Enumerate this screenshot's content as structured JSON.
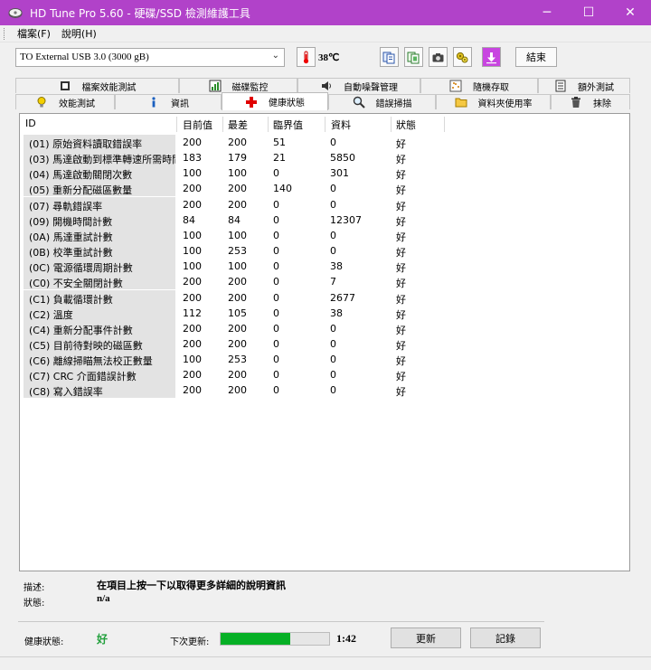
{
  "window": {
    "title": "HD Tune Pro 5.60 - 硬碟/SSD 檢測維護工具",
    "minimize": "─",
    "maximize": "☐",
    "close": "✕",
    "accent": "#b142c9"
  },
  "menu": {
    "file": "檔案(F)",
    "help": "說明(H)"
  },
  "toolbar": {
    "drive": "TO External USB 3.0 (3000 gB)",
    "temperature": "38℃",
    "exit_label": "結束",
    "icons": [
      "thermometer-icon",
      "copy-text-icon",
      "copy-screen-icon",
      "screenshot-icon",
      "options-icon",
      "save-download-icon"
    ]
  },
  "tabs": {
    "row1": [
      "檔案效能測試",
      "磁碟監控",
      "自動噪聲管理",
      "隨機存取",
      "額外測試"
    ],
    "row2": [
      "效能測試",
      "資訊",
      "健康狀態",
      "錯誤掃描",
      "資料夾使用率",
      "抹除"
    ],
    "active": "健康狀態"
  },
  "table": {
    "headers": [
      "ID",
      "目前值",
      "最差",
      "臨界值",
      "資料",
      "狀態"
    ],
    "rows": [
      [
        "(01) 原始資料讀取錯誤率",
        "200",
        "200",
        "51",
        "0",
        "好"
      ],
      [
        "(03) 馬達啟動到標準轉速所需時間",
        "183",
        "179",
        "21",
        "5850",
        "好"
      ],
      [
        "(04) 馬達啟動關閉次數",
        "100",
        "100",
        "0",
        "301",
        "好"
      ],
      [
        "(05) 重新分配磁區數量",
        "200",
        "200",
        "140",
        "0",
        "好"
      ],
      [
        "(07) 尋軌錯誤率",
        "200",
        "200",
        "0",
        "0",
        "好"
      ],
      [
        "(09) 開機時間計數",
        "84",
        "84",
        "0",
        "12307",
        "好"
      ],
      [
        "(0A) 馬達重試計數",
        "100",
        "100",
        "0",
        "0",
        "好"
      ],
      [
        "(0B) 校準重試計數",
        "100",
        "253",
        "0",
        "0",
        "好"
      ],
      [
        "(0C) 電源循環周期計數",
        "100",
        "100",
        "0",
        "38",
        "好"
      ],
      [
        "(C0) 不安全關閉計數",
        "200",
        "200",
        "0",
        "7",
        "好"
      ],
      [
        "(C1) 負載循環計數",
        "200",
        "200",
        "0",
        "2677",
        "好"
      ],
      [
        "(C2) 溫度",
        "112",
        "105",
        "0",
        "38",
        "好"
      ],
      [
        "(C4) 重新分配事件計數",
        "200",
        "200",
        "0",
        "0",
        "好"
      ],
      [
        "(C5) 目前待對映的磁區數",
        "200",
        "200",
        "0",
        "0",
        "好"
      ],
      [
        "(C6) 離線掃瞄無法校正數量",
        "100",
        "253",
        "0",
        "0",
        "好"
      ],
      [
        "(C7) CRC 介面錯誤計數",
        "200",
        "200",
        "0",
        "0",
        "好"
      ],
      [
        "(C8) 寫入錯誤率",
        "200",
        "200",
        "0",
        "0",
        "好"
      ]
    ]
  },
  "details": {
    "description_label": "描述:",
    "description": "在項目上按一下以取得更多詳細的說明資訊",
    "status_label": "狀態:",
    "status": "n/a"
  },
  "footer": {
    "health_label": "健康狀態:",
    "health_value": "好",
    "health_color": "#22a03c",
    "next_update_label": "下次更新:",
    "progress_fraction": 0.64,
    "countdown": "1:42",
    "refresh_label": "更新",
    "log_label": "記錄"
  }
}
